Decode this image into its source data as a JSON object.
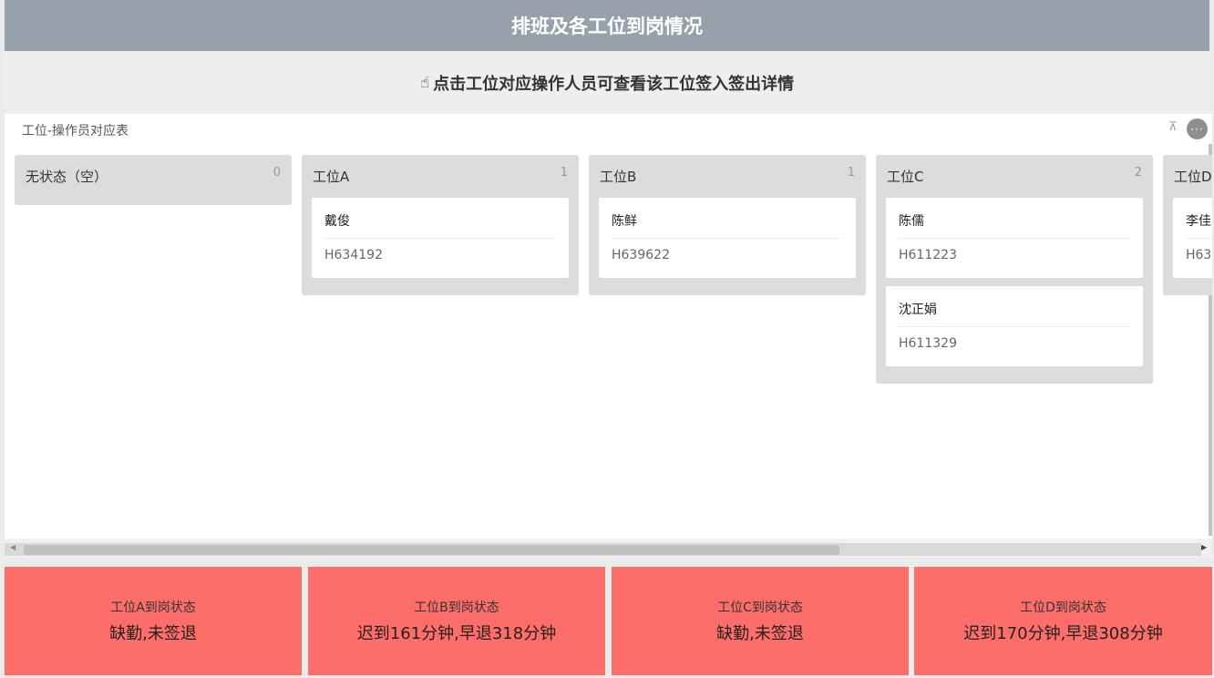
{
  "header": {
    "title": "排班及各工位到岗情况"
  },
  "hint": {
    "icon": "pointing-hand-icon",
    "text": "点击工位对应操作人员可查看该工位签入签出详情"
  },
  "board": {
    "title": "工位-操作员对应表",
    "columns": [
      {
        "name": "无状态（空）",
        "count": "0",
        "cards": []
      },
      {
        "name": "工位A",
        "count": "1",
        "cards": [
          {
            "name": "戴俊",
            "id": "H634192"
          }
        ]
      },
      {
        "name": "工位B",
        "count": "1",
        "cards": [
          {
            "name": "陈鲜",
            "id": "H639622"
          }
        ]
      },
      {
        "name": "工位C",
        "count": "2",
        "cards": [
          {
            "name": "陈儒",
            "id": "H611223"
          },
          {
            "name": "沈正娟",
            "id": "H611329"
          }
        ]
      },
      {
        "name": "工位D",
        "count": "",
        "cards": [
          {
            "name": "李佳",
            "id": "H63"
          }
        ]
      }
    ]
  },
  "status_tiles": [
    {
      "label": "工位A到岗状态",
      "value": "缺勤,未签退"
    },
    {
      "label": "工位B到岗状态",
      "value": "迟到161分钟,早退318分钟"
    },
    {
      "label": "工位C到岗状态",
      "value": "缺勤,未签退"
    },
    {
      "label": "工位D到岗状态",
      "value": "迟到170分钟,早退308分钟"
    }
  ],
  "colors": {
    "title_bar": "#97a1ab",
    "status_tile": "#fd6d6a",
    "column_bg": "#dcdcdc"
  }
}
